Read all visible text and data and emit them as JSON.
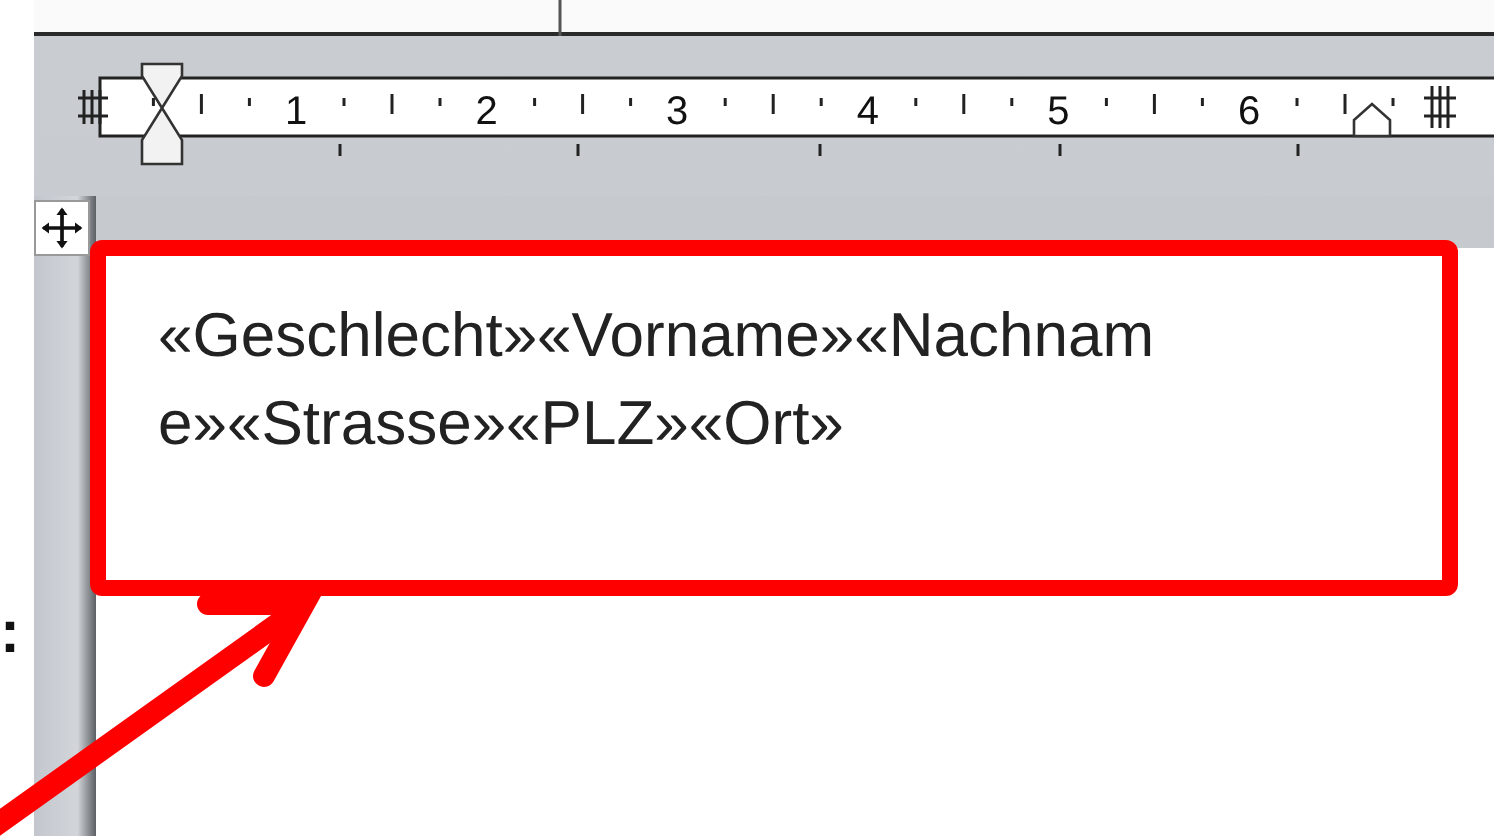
{
  "ruler": {
    "numbers": [
      "1",
      "2",
      "3",
      "4",
      "5",
      "6"
    ]
  },
  "margin_text": ":",
  "document": {
    "lines": [
      "«Geschlecht»«Vorname»«Nachnam",
      "e»«Strasse»«PLZ»«Ort»"
    ]
  }
}
